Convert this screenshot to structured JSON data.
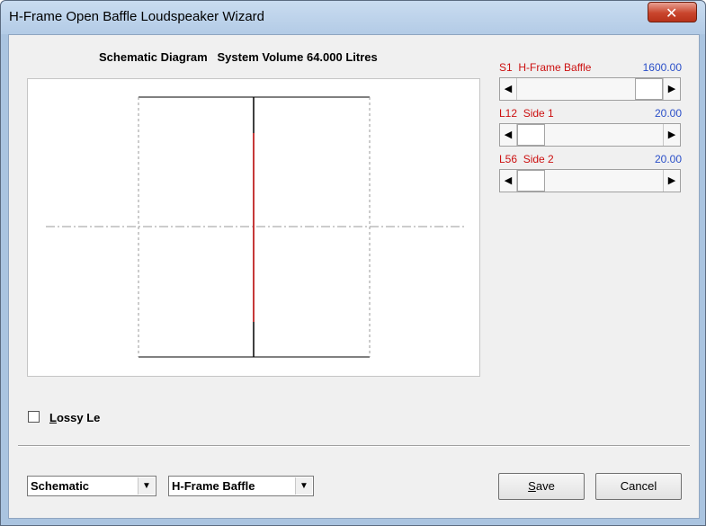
{
  "window": {
    "title": "H-Frame Open Baffle Loudspeaker Wizard",
    "close_glyph": "✕"
  },
  "diagram": {
    "heading": "Schematic Diagram   System Volume 64.000 Litres"
  },
  "parameters": [
    {
      "label": "S1  H-Frame Baffle",
      "value": "1600.00",
      "position": 0.83
    },
    {
      "label": "L12  Side 1",
      "value": "20.00",
      "position": 0.1
    },
    {
      "label": "L56  Side 2",
      "value": "20.00",
      "position": 0.1
    }
  ],
  "scroll_arrows": {
    "left": "◀",
    "right": "▶"
  },
  "options": {
    "lossy_checked": false,
    "lossy_label": "Lossy Le"
  },
  "footer": {
    "view_select": "Schematic",
    "type_select": "H-Frame Baffle",
    "dropdown_glyph": "▼",
    "save_label": "Save",
    "cancel_label": "Cancel"
  },
  "colors": {
    "param_label": "#cc1010",
    "param_value": "#2a4fc8",
    "driver_line": "#dd2222"
  }
}
